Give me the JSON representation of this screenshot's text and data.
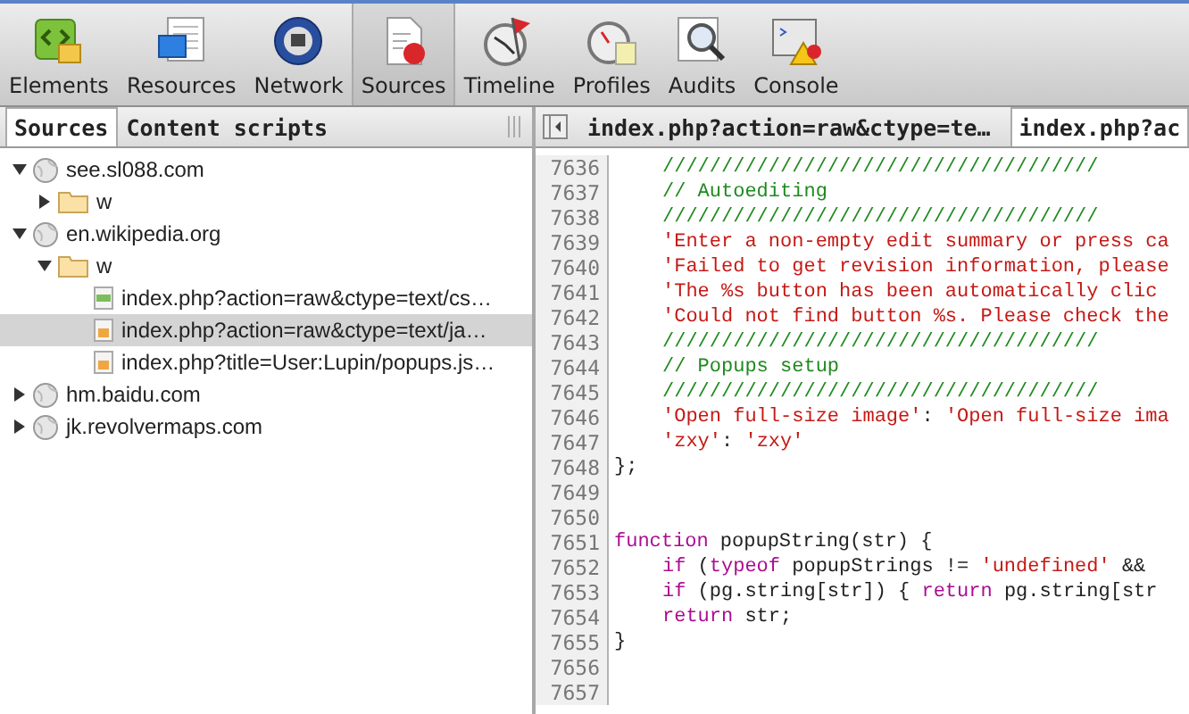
{
  "toolbar": [
    {
      "label": "Elements",
      "selected": false
    },
    {
      "label": "Resources",
      "selected": false
    },
    {
      "label": "Network",
      "selected": false
    },
    {
      "label": "Sources",
      "selected": true
    },
    {
      "label": "Timeline",
      "selected": false
    },
    {
      "label": "Profiles",
      "selected": false
    },
    {
      "label": "Audits",
      "selected": false
    },
    {
      "label": "Console",
      "selected": false
    }
  ],
  "sidebar": {
    "tabs": [
      {
        "label": "Sources",
        "selected": true
      },
      {
        "label": "Content scripts",
        "selected": false
      }
    ],
    "tree": [
      {
        "kind": "domain",
        "label": "see.sl088.com",
        "expanded": true,
        "selected": false,
        "children": [
          {
            "kind": "folder",
            "label": "w",
            "expanded": false,
            "selected": false
          }
        ]
      },
      {
        "kind": "domain",
        "label": "en.wikipedia.org",
        "expanded": true,
        "selected": false,
        "children": [
          {
            "kind": "folder",
            "label": "w",
            "expanded": true,
            "selected": false,
            "children": [
              {
                "kind": "css",
                "label": "index.php?action=raw&ctype=text/cs…",
                "selected": false
              },
              {
                "kind": "js",
                "label": "index.php?action=raw&ctype=text/ja…",
                "selected": true
              },
              {
                "kind": "js",
                "label": "index.php?title=User:Lupin/popups.js…",
                "selected": false
              }
            ]
          }
        ]
      },
      {
        "kind": "domain",
        "label": "hm.baidu.com",
        "expanded": false,
        "selected": false
      },
      {
        "kind": "domain",
        "label": "jk.revolvermaps.com",
        "expanded": false,
        "selected": false
      }
    ]
  },
  "editor": {
    "tabs": [
      {
        "label": "index.php?action=raw&ctype=te…",
        "selected": false
      },
      {
        "label": "index.php?ac",
        "selected": true
      }
    ],
    "lines": [
      {
        "number": "7636",
        "indented": true,
        "tokens": [
          {
            "kind": "comment",
            "text": "/////////////////////////////////////"
          }
        ]
      },
      {
        "number": "7637",
        "indented": true,
        "tokens": [
          {
            "kind": "comment",
            "text": "// Autoediting"
          }
        ]
      },
      {
        "number": "7638",
        "indented": true,
        "tokens": [
          {
            "kind": "comment",
            "text": "/////////////////////////////////////"
          }
        ]
      },
      {
        "number": "7639",
        "indented": true,
        "tokens": [
          {
            "kind": "string",
            "text": "'Enter a non-empty edit summary or press ca"
          }
        ]
      },
      {
        "number": "7640",
        "indented": true,
        "tokens": [
          {
            "kind": "string",
            "text": "'Failed to get revision information, please"
          }
        ]
      },
      {
        "number": "7641",
        "indented": true,
        "tokens": [
          {
            "kind": "string",
            "text": "'The %s button has been automatically clic"
          }
        ]
      },
      {
        "number": "7642",
        "indented": true,
        "tokens": [
          {
            "kind": "string",
            "text": "'Could not find button %s. Please check the"
          }
        ]
      },
      {
        "number": "7643",
        "indented": true,
        "tokens": [
          {
            "kind": "comment",
            "text": "/////////////////////////////////////"
          }
        ]
      },
      {
        "number": "7644",
        "indented": true,
        "tokens": [
          {
            "kind": "comment",
            "text": "// Popups setup"
          }
        ]
      },
      {
        "number": "7645",
        "indented": true,
        "tokens": [
          {
            "kind": "comment",
            "text": "/////////////////////////////////////"
          }
        ]
      },
      {
        "number": "7646",
        "indented": true,
        "tokens": [
          {
            "kind": "string",
            "text": "'Open full-size image'"
          },
          {
            "kind": "plain",
            "text": ": "
          },
          {
            "kind": "string",
            "text": "'Open full-size ima"
          }
        ]
      },
      {
        "number": "7647",
        "indented": true,
        "tokens": [
          {
            "kind": "string",
            "text": "'zxy'"
          },
          {
            "kind": "plain",
            "text": ": "
          },
          {
            "kind": "string",
            "text": "'zxy'"
          }
        ]
      },
      {
        "number": "7648",
        "indented": false,
        "tokens": [
          {
            "kind": "plain",
            "text": "};"
          }
        ]
      },
      {
        "number": "7649"
      },
      {
        "number": "7650"
      },
      {
        "number": "7651",
        "indented": false,
        "tokens": [
          {
            "kind": "keyword",
            "text": "function"
          },
          {
            "kind": "plain",
            "text": " popupString(str) {"
          }
        ]
      },
      {
        "number": "7652",
        "indented": true,
        "tokens": [
          {
            "kind": "keyword",
            "text": "if"
          },
          {
            "kind": "plain",
            "text": " ("
          },
          {
            "kind": "keyword",
            "text": "typeof"
          },
          {
            "kind": "plain",
            "text": " popupStrings != "
          },
          {
            "kind": "string",
            "text": "'undefined'"
          },
          {
            "kind": "plain",
            "text": " &&"
          }
        ]
      },
      {
        "number": "7653",
        "indented": true,
        "tokens": [
          {
            "kind": "keyword",
            "text": "if"
          },
          {
            "kind": "plain",
            "text": " (pg.string[str]) { "
          },
          {
            "kind": "keyword",
            "text": "return"
          },
          {
            "kind": "plain",
            "text": " pg.string[str"
          }
        ]
      },
      {
        "number": "7654",
        "indented": true,
        "tokens": [
          {
            "kind": "keyword",
            "text": "return"
          },
          {
            "kind": "plain",
            "text": " str;"
          }
        ]
      },
      {
        "number": "7655",
        "indented": false,
        "tokens": [
          {
            "kind": "plain",
            "text": "}"
          }
        ]
      },
      {
        "number": "7656"
      },
      {
        "number": "7657"
      }
    ]
  }
}
